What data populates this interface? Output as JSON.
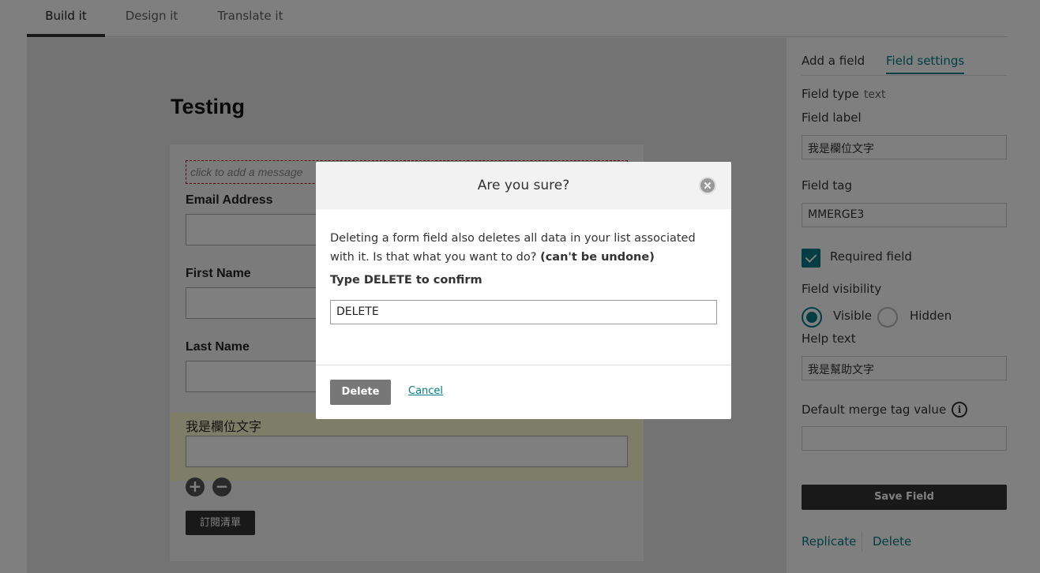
{
  "tabs": [
    {
      "label": "Build it",
      "active": true
    },
    {
      "label": "Design it",
      "active": false
    },
    {
      "label": "Translate it",
      "active": false
    }
  ],
  "form": {
    "title": "Testing",
    "message_placeholder": "click to add a message",
    "fields": [
      {
        "label": "Email Address"
      },
      {
        "label": "First Name"
      },
      {
        "label": "Last Name"
      },
      {
        "label": "我是欄位文字"
      }
    ],
    "add_icon": "plus-circle-icon",
    "remove_icon": "minus-circle-icon",
    "subscribe_label": "訂閱清單"
  },
  "panel": {
    "tabs": [
      {
        "label": "Add a field",
        "active": false
      },
      {
        "label": "Field settings",
        "active": true
      }
    ],
    "field_type_label": "Field type",
    "field_type_value": "text",
    "field_label_label": "Field label",
    "field_label_value": "我是欄位文字",
    "field_tag_label": "Field tag",
    "field_tag_value": "MMERGE3",
    "required_label": "Required field",
    "required_checked": true,
    "visibility_label": "Field visibility",
    "visibility_options": [
      {
        "label": "Visible",
        "selected": true
      },
      {
        "label": "Hidden",
        "selected": false
      }
    ],
    "help_text_label": "Help text",
    "help_text_value": "我是幫助文字",
    "default_merge_label": "Default merge tag value",
    "default_merge_value": "",
    "save_label": "Save Field",
    "replicate_label": "Replicate",
    "delete_label": "Delete"
  },
  "modal": {
    "title": "Are you sure?",
    "body_text": "Deleting a form field also deletes all data in your list associated with it. Is that what you want to do?",
    "body_bold": "(can't be undone)",
    "confirm_label": "Type DELETE to confirm",
    "confirm_value": "DELETE",
    "delete_label": "Delete",
    "cancel_label": "Cancel"
  },
  "colors": {
    "accent": "#007c89",
    "dark_button": "#333333",
    "overlay": "rgba(0,0,0,0.5)",
    "highlight_row": "#fbfbd1"
  }
}
